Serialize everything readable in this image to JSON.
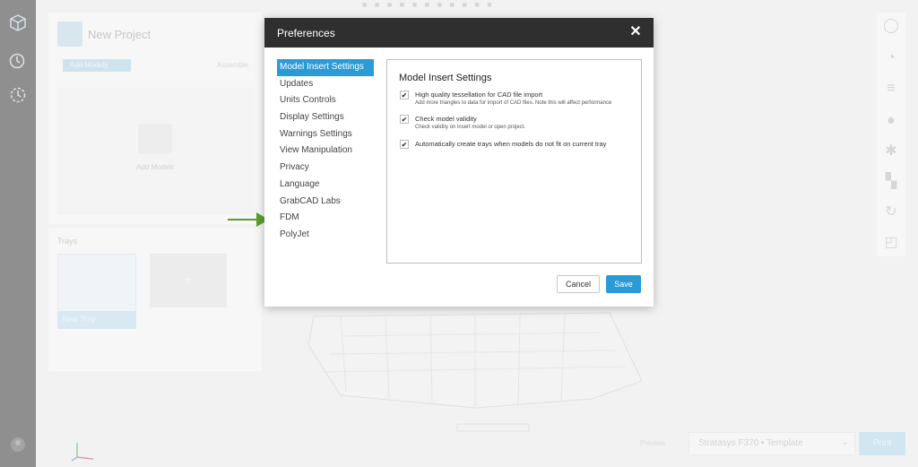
{
  "app": {
    "project_title": "New Project",
    "add_models_button": "Add Models",
    "assemble_label": "Assemble",
    "add_models_placeholder": "Add Models",
    "trays_label": "Trays",
    "tray_name": "New Tray",
    "add_tray_label": "+",
    "printer_select": "Stratasys F370 • Template",
    "print_button": "Print",
    "preview_label": "Preview"
  },
  "dialog": {
    "title": "Preferences",
    "close_label": "✕",
    "nav_items": [
      "Model Insert Settings",
      "Updates",
      "Units Controls",
      "Display Settings",
      "Warnings Settings",
      "View Manipulation",
      "Privacy",
      "Language",
      "GrabCAD Labs",
      "FDM",
      "PolyJet"
    ],
    "active_nav": "Model Insert Settings",
    "content_title": "Model Insert Settings",
    "options": [
      {
        "label": "High quality tessellation for CAD file import",
        "description": "Add more triangles to data for import of CAD files. Note this will affect performance",
        "checked": true
      },
      {
        "label": "Check model validity",
        "description": "Check validity on insert model or open project.",
        "checked": true
      },
      {
        "label": "Automatically create trays when models do not fit on current tray",
        "description": "",
        "checked": true
      }
    ],
    "check_glyph": "✔",
    "cancel_label": "Cancel",
    "save_label": "Save"
  },
  "colors": {
    "accent": "#2a9bd6",
    "header_bg": "#2f2f2f",
    "annotation_arrow": "#5a9e2f"
  }
}
